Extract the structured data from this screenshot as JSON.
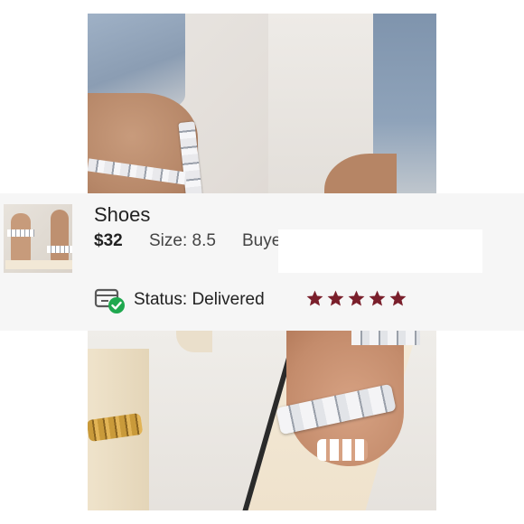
{
  "item": {
    "title": "Shoes",
    "price": "$32",
    "size_label": "Size: 8.5",
    "buyer_label": "Buyer"
  },
  "status": {
    "label": "Status:",
    "value": "Delivered",
    "icon": "delivered-box-icon"
  },
  "rating": {
    "value": 5,
    "max": 5,
    "star_color": "#7a1f2b",
    "icon": "star-icon"
  },
  "colors": {
    "card_bg": "#f6f6f6",
    "check_green": "#1fa84f"
  }
}
